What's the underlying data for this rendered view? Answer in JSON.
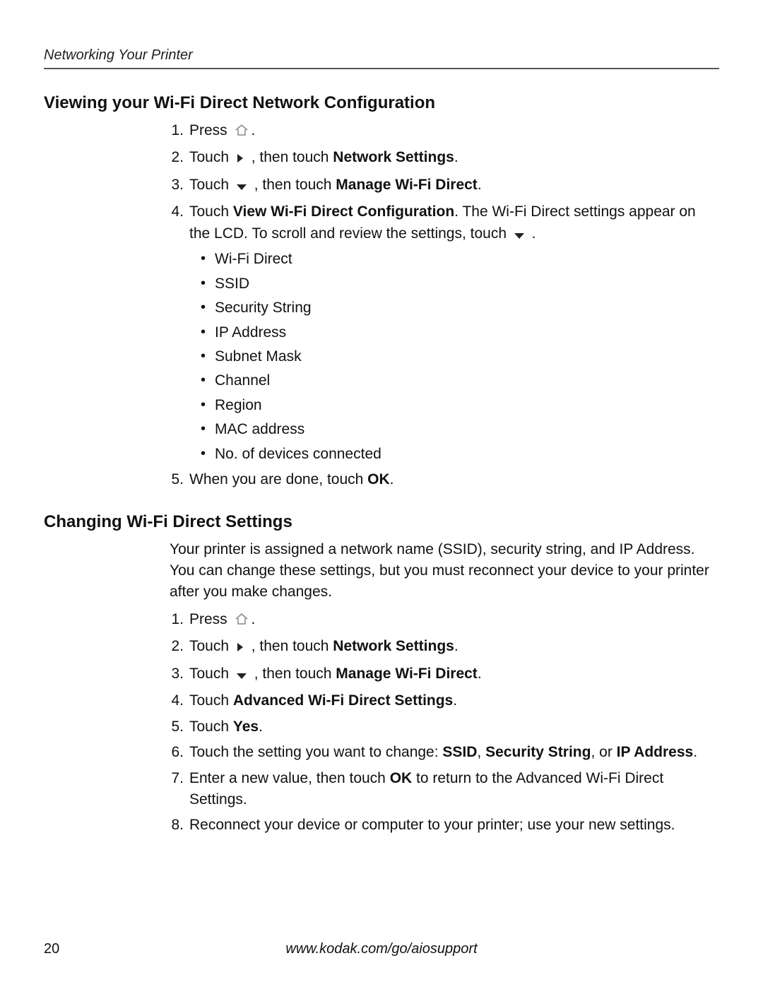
{
  "runningHeader": "Networking Your Printer",
  "pageNumber": "20",
  "footerUrl": "www.kodak.com/go/aiosupport",
  "section1": {
    "title": "Viewing your Wi-Fi Direct Network Configuration",
    "steps": {
      "s1_prefix": "Press ",
      "s1_suffix": ".",
      "s2_a": "Touch ",
      "s2_b": " , then touch ",
      "s2_bold": "Network Settings",
      "s2_c": ".",
      "s3_a": "Touch ",
      "s3_b": " , then touch ",
      "s3_bold": "Manage Wi-Fi Direct",
      "s3_c": ".",
      "s4_a": "Touch ",
      "s4_bold": "View Wi-Fi Direct Configuration",
      "s4_b": ". The Wi-Fi Direct settings appear on the LCD. To scroll and review the settings, touch ",
      "s4_c": " .",
      "s5_a": "When you are done, touch ",
      "s5_bold": "OK",
      "s5_b": "."
    },
    "bullets": [
      "Wi-Fi Direct",
      "SSID",
      "Security String",
      "IP Address",
      "Subnet Mask",
      "Channel",
      "Region",
      "MAC address",
      "No. of devices connected"
    ]
  },
  "section2": {
    "title": "Changing Wi-Fi Direct Settings",
    "intro": "Your printer is assigned a network name (SSID), security string, and IP Address. You can change these settings, but you must reconnect your device to your printer after you make changes.",
    "steps": {
      "s1_prefix": "Press ",
      "s1_suffix": ".",
      "s2_a": "Touch ",
      "s2_b": " , then touch ",
      "s2_bold": "Network Settings",
      "s2_c": ".",
      "s3_a": "Touch ",
      "s3_b": " , then touch ",
      "s3_bold": "Manage Wi-Fi Direct",
      "s3_c": ".",
      "s4_a": "Touch ",
      "s4_bold": "Advanced Wi-Fi Direct Settings",
      "s4_b": ".",
      "s5_a": "Touch ",
      "s5_bold": "Yes",
      "s5_b": ".",
      "s6_a": "Touch the setting you want to change: ",
      "s6_b1": "SSID",
      "s6_b2": "Security String",
      "s6_b3": "IP Address",
      "s6_sep1": ", ",
      "s6_sep2": ", or ",
      "s6_c": ".",
      "s7_a": "Enter a new value, then touch ",
      "s7_bold": "OK",
      "s7_b": " to return to the Advanced Wi-Fi Direct Settings.",
      "s8": "Reconnect your device or computer to your printer; use your new settings."
    }
  }
}
